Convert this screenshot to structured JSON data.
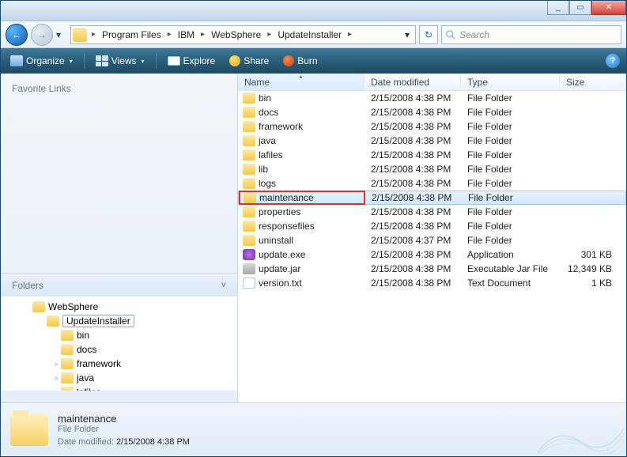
{
  "window_controls": {
    "min": "_",
    "max": "▭",
    "close": "✕"
  },
  "nav": {
    "back_glyph": "←",
    "fwd_glyph": "→",
    "dd_glyph": "▾",
    "refresh_glyph": "↻"
  },
  "breadcrumb": {
    "segments": [
      "Program Files",
      "IBM",
      "WebSphere",
      "UpdateInstaller"
    ],
    "sep": "▸",
    "dd_end": "▾"
  },
  "search": {
    "placeholder": "Search"
  },
  "toolbar": {
    "organize": "Organize",
    "views": "Views",
    "explore": "Explore",
    "share": "Share",
    "burn": "Burn",
    "dd": "▾"
  },
  "left": {
    "favorites": "Favorite Links",
    "folders": "Folders",
    "chev_down": "˅",
    "chev_up": "˄",
    "tree": [
      {
        "label": "WebSphere",
        "indent": 0,
        "tw": ""
      },
      {
        "label": "UpdateInstaller",
        "indent": 1,
        "tw": "",
        "selected": true
      },
      {
        "label": "bin",
        "indent": 2,
        "tw": ""
      },
      {
        "label": "docs",
        "indent": 2,
        "tw": ""
      },
      {
        "label": "framework",
        "indent": 2,
        "tw": "▹"
      },
      {
        "label": "java",
        "indent": 2,
        "tw": "▹"
      },
      {
        "label": "lafiles",
        "indent": 2,
        "tw": ""
      }
    ]
  },
  "columns": {
    "name": "Name",
    "date": "Date modified",
    "type": "Type",
    "size": "Size",
    "sort_glyph": "▴"
  },
  "files": [
    {
      "name": "bin",
      "date": "2/15/2008 4:38 PM",
      "type": "File Folder",
      "size": "",
      "ico": "folder"
    },
    {
      "name": "docs",
      "date": "2/15/2008 4:38 PM",
      "type": "File Folder",
      "size": "",
      "ico": "folder"
    },
    {
      "name": "framework",
      "date": "2/15/2008 4:38 PM",
      "type": "File Folder",
      "size": "",
      "ico": "folder"
    },
    {
      "name": "java",
      "date": "2/15/2008 4:38 PM",
      "type": "File Folder",
      "size": "",
      "ico": "folder"
    },
    {
      "name": "lafiles",
      "date": "2/15/2008 4:38 PM",
      "type": "File Folder",
      "size": "",
      "ico": "folder"
    },
    {
      "name": "lib",
      "date": "2/15/2008 4:38 PM",
      "type": "File Folder",
      "size": "",
      "ico": "folder"
    },
    {
      "name": "logs",
      "date": "2/15/2008 4:38 PM",
      "type": "File Folder",
      "size": "",
      "ico": "folder"
    },
    {
      "name": "maintenance",
      "date": "2/15/2008 4:38 PM",
      "type": "File Folder",
      "size": "",
      "ico": "folder",
      "selected": true,
      "highlighted": true
    },
    {
      "name": "properties",
      "date": "2/15/2008 4:38 PM",
      "type": "File Folder",
      "size": "",
      "ico": "folder"
    },
    {
      "name": "responsefiles",
      "date": "2/15/2008 4:38 PM",
      "type": "File Folder",
      "size": "",
      "ico": "folder"
    },
    {
      "name": "uninstall",
      "date": "2/15/2008 4:37 PM",
      "type": "File Folder",
      "size": "",
      "ico": "folder"
    },
    {
      "name": "update.exe",
      "date": "2/15/2008 4:38 PM",
      "type": "Application",
      "size": "301 KB",
      "ico": "exe"
    },
    {
      "name": "update.jar",
      "date": "2/15/2008 4:38 PM",
      "type": "Executable Jar File",
      "size": "12,349 KB",
      "ico": "jar"
    },
    {
      "name": "version.txt",
      "date": "2/15/2008 4:38 PM",
      "type": "Text Document",
      "size": "1 KB",
      "ico": "txt"
    }
  ],
  "details": {
    "name": "maintenance",
    "type": "File Folder",
    "mod_label": "Date modified:",
    "mod_value": "2/15/2008 4:38 PM"
  }
}
